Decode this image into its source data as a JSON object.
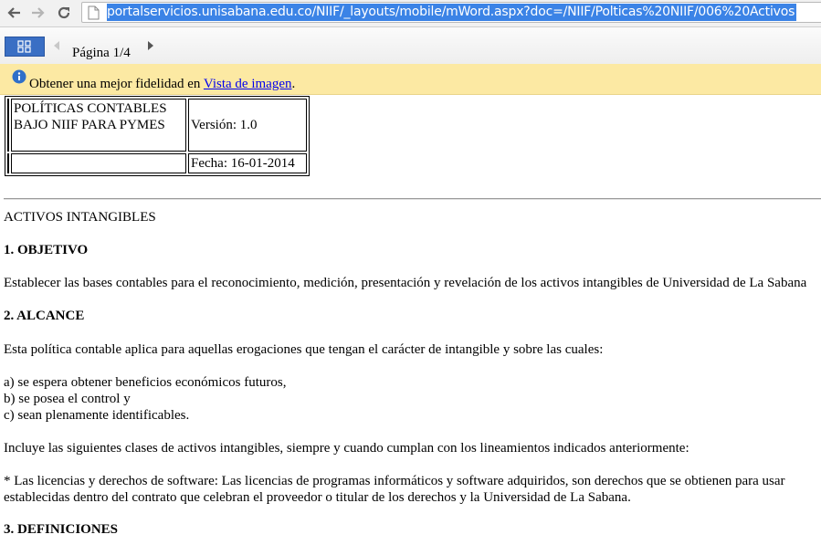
{
  "browser": {
    "url": "portalservicios.unisabana.edu.co/NIIF/_layouts/mobile/mWord.aspx?doc=/NIIF/Polticas%20NIIF/006%20Activos",
    "back_icon": "arrow-left-icon",
    "forward_icon": "arrow-right-icon",
    "reload_icon": "reload-icon"
  },
  "toolbar": {
    "page_label": "Página 1/4"
  },
  "infobar": {
    "text": "Obtener una mejor fidelidad en ",
    "link": "Vista de imagen",
    "suffix": "."
  },
  "header_table": {
    "title_line1": "POLÍTICAS CONTABLES",
    "title_line2": "BAJO NIIF PARA PYMES",
    "version": "Versión: 1.0",
    "date": "Fecha: 16-01-2014"
  },
  "document": {
    "section_title": "ACTIVOS INTANGIBLES",
    "h1": "1. OBJETIVO",
    "p1": "Establecer las bases contables para el reconocimiento, medición, presentación y revelación de los activos intangibles de Universidad de La Sabana",
    "h2": "2. ALCANCE",
    "p2": "Esta política contable aplica para aquellas erogaciones que tengan el carácter de intangible y sobre las cuales:",
    "list": [
      "a) se espera obtener beneficios económicos futuros,",
      "b) se posea el control y",
      "c) sean plenamente identificables."
    ],
    "p3": "Incluye las siguientes clases de activos intangibles, siempre y cuando cumplan con los lineamientos indicados anteriormente:",
    "p4_line1": "* Las licencias y derechos de software: Las licencias de programas informáticos y software adquiridos, son derechos que se obtienen para usar",
    "p4_line2": "establecidas dentro del contrato que celebran el proveedor o titular de los derechos y la Universidad de La Sabana.",
    "h3": "3. DEFINICIONES"
  },
  "colors": {
    "infobar_bg": "#fce9a3",
    "url_highlight": "#3b83e6",
    "view_button": "#3a6fc4"
  }
}
